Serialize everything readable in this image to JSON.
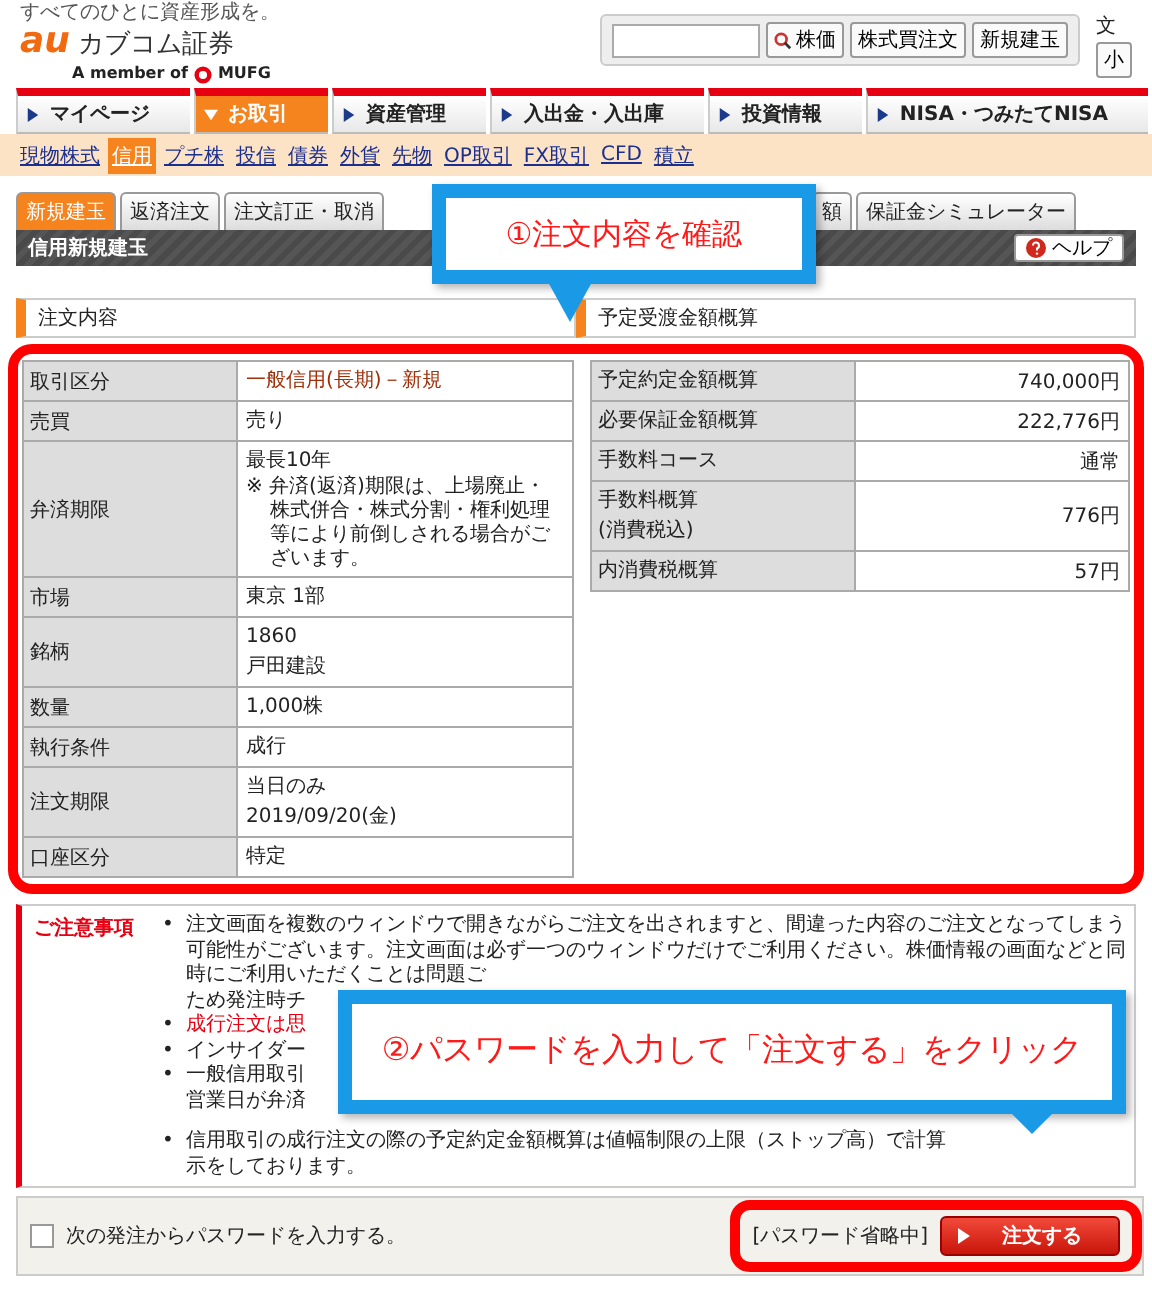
{
  "header": {
    "tagline": "すべてのひとに資産形成を。",
    "logo_mark": "au",
    "logo_name": "カブコム証券",
    "member": "A member of",
    "group": "MUFG",
    "buttons": [
      "株価",
      "株式買注文",
      "新規建玉"
    ],
    "side_label": "文",
    "size_button": "小"
  },
  "nav": [
    {
      "label": "マイページ",
      "selected": false
    },
    {
      "label": "お取引",
      "selected": true
    },
    {
      "label": "資産管理",
      "selected": false
    },
    {
      "label": "入出金・入出庫",
      "selected": false
    },
    {
      "label": "投資情報",
      "selected": false
    },
    {
      "label": "NISA・つみたてNISA",
      "selected": false
    }
  ],
  "subnav": [
    {
      "label": "現物株式",
      "selected": false
    },
    {
      "label": "信用",
      "selected": true
    },
    {
      "label": "プチ株",
      "selected": false
    },
    {
      "label": "投信",
      "selected": false
    },
    {
      "label": "債券",
      "selected": false
    },
    {
      "label": "外貨",
      "selected": false
    },
    {
      "label": "先物",
      "selected": false
    },
    {
      "label": "OP取引",
      "selected": false
    },
    {
      "label": "FX取引",
      "selected": false
    },
    {
      "label": "CFD",
      "selected": false
    },
    {
      "label": "積立",
      "selected": false
    }
  ],
  "tabs": [
    {
      "label": "新規建玉",
      "selected": true
    },
    {
      "label": "返済注文",
      "selected": false
    },
    {
      "label": "注文訂正・取消",
      "selected": false
    },
    {
      "label": "額",
      "selected": false
    },
    {
      "label": "保証金シミュレーター",
      "selected": false
    }
  ],
  "page_title": "信用新規建玉",
  "help_button": "ヘルプ",
  "order": {
    "heading": "注文内容",
    "rows": [
      {
        "label": "取引区分",
        "kind": "accent",
        "lines": [
          "一般信用(長期)－新規"
        ]
      },
      {
        "label": "売買",
        "kind": "plain",
        "lines": [
          "売り"
        ]
      },
      {
        "label": "弁済期限",
        "kind": "plain",
        "lines": [
          "最長10年"
        ],
        "note": "※ 弁済(返済)期限は、上場廃止・株式併合・株式分割・権利処理等により前倒しされる場合がございます。"
      },
      {
        "label": "市場",
        "kind": "plain",
        "lines": [
          "東京 1部"
        ]
      },
      {
        "label": "銘柄",
        "kind": "plain",
        "lines": [
          "1860",
          "戸田建設"
        ]
      },
      {
        "label": "数量",
        "kind": "plain",
        "lines": [
          "1,000株"
        ]
      },
      {
        "label": "執行条件",
        "kind": "plain",
        "lines": [
          "成行"
        ]
      },
      {
        "label": "注文期限",
        "kind": "plain",
        "lines": [
          "当日のみ",
          "2019/09/20(金)"
        ]
      },
      {
        "label": "口座区分",
        "kind": "plain",
        "lines": [
          "特定"
        ]
      }
    ]
  },
  "estimate": {
    "heading": "予定受渡金額概算",
    "rows": [
      {
        "label": "予定約定金額概算",
        "value": "740,000円"
      },
      {
        "label": "必要保証金額概算",
        "value": "222,776円"
      },
      {
        "label": "手数料コース",
        "value": "通常"
      },
      {
        "label": "手数料概算",
        "sublabel": "(消費税込)",
        "value": "776円"
      },
      {
        "label": "内消費税概算",
        "value": "57円"
      }
    ]
  },
  "notice": {
    "title": "ご注意事項",
    "marker": "•",
    "bullets": [
      {
        "kind": "normal",
        "parts": [
          "注文画面を複数のウィンドウで開きながらご注文を出されますと、間違った内容のご注文となってしまう可能性がございます。注文画面は必ず一つのウィンドウだけでご利用ください。株価情報の画面などと同時にご利用いただくことは問題ご",
          "ため発注時チ"
        ]
      },
      {
        "kind": "warning",
        "parts": [
          "成行注文は思"
        ]
      },
      {
        "kind": "normal",
        "parts": [
          "インサイダー"
        ]
      },
      {
        "kind": "normal",
        "parts": [
          "一般信用取引",
          "営業日が弁済"
        ]
      },
      {
        "kind": "normal",
        "parts": [
          "信用取引の成行注文の際の予定約定金額概算は値幅制限の上限（ストップ高）で計算",
          "示をしております。"
        ]
      }
    ]
  },
  "footer": {
    "remember_password": {
      "label": "次の発注からパスワードを入力する。",
      "checked": false
    },
    "password_status": "[パスワード省略中]",
    "submit_button": "注文する"
  },
  "callouts": [
    {
      "text": "①注文内容を確認"
    },
    {
      "text": "②パスワードを入力して「注文する」をクリック"
    }
  ]
}
